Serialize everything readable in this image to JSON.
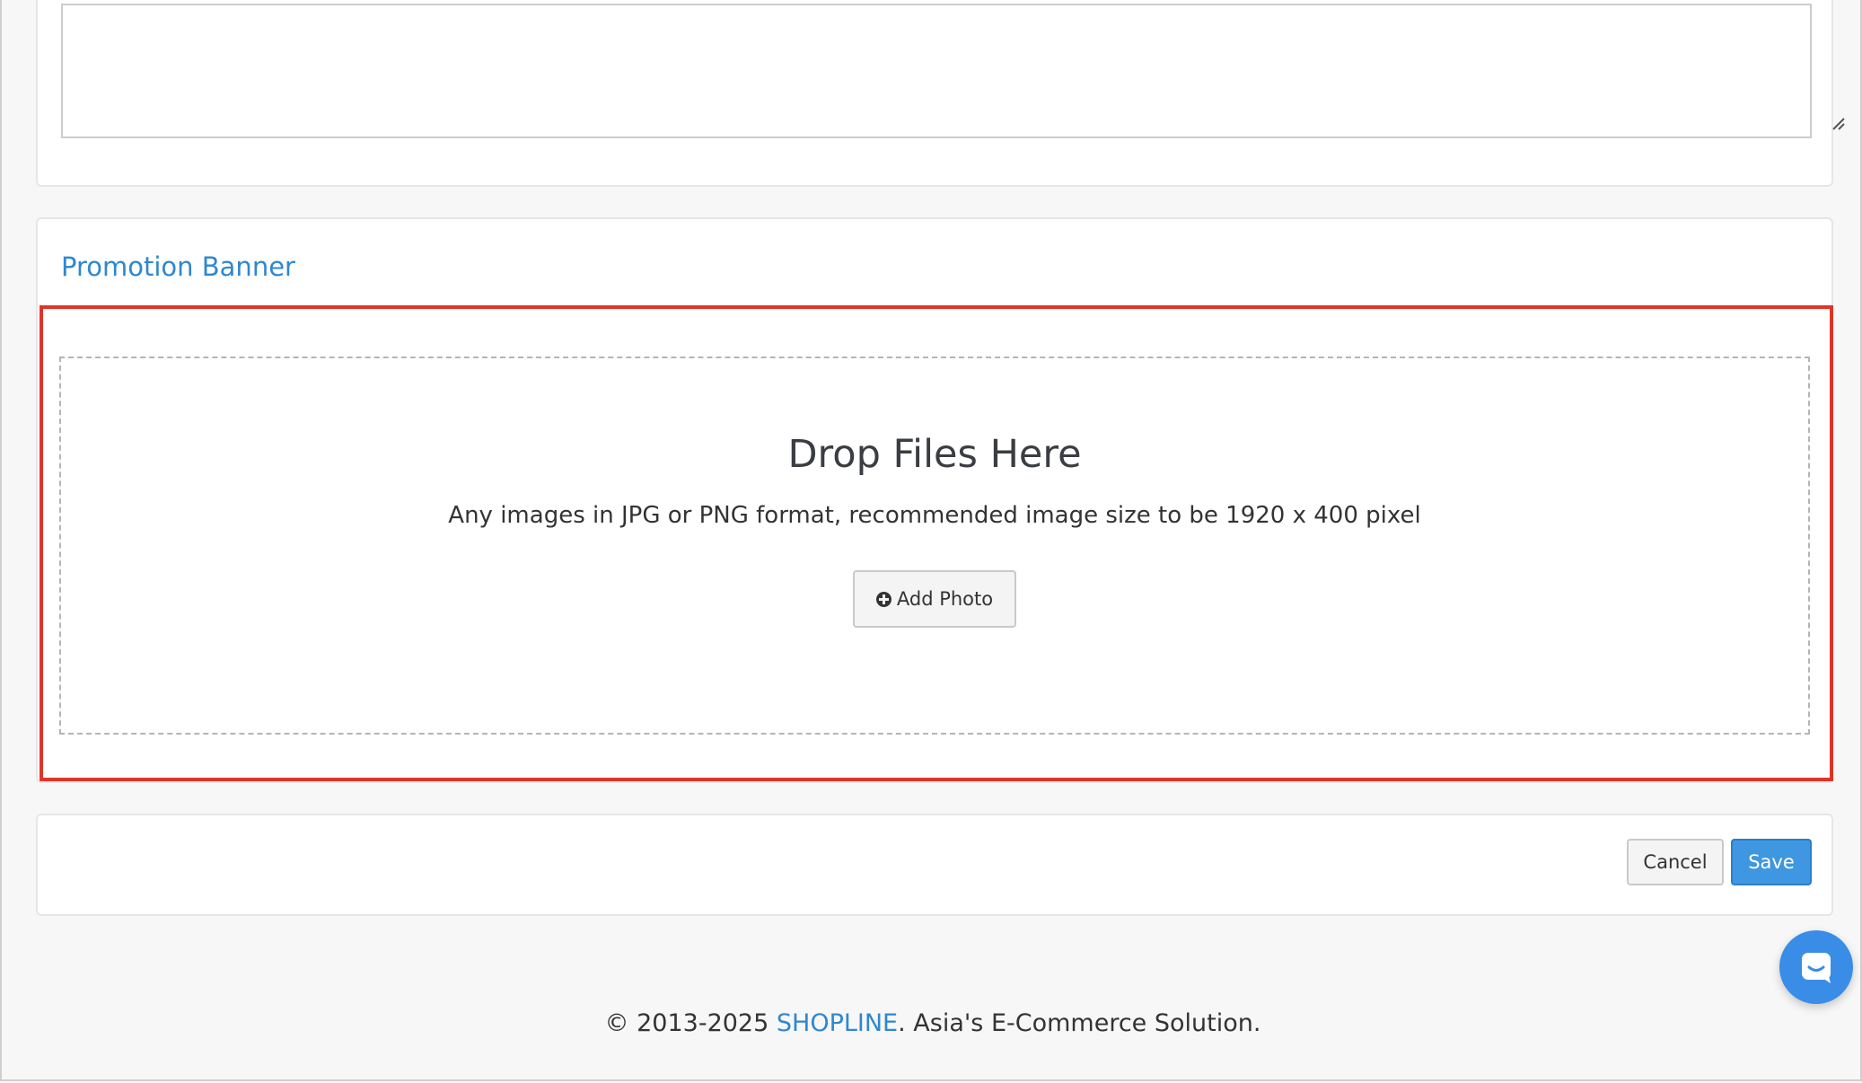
{
  "description_field": {
    "value": ""
  },
  "promotion_banner": {
    "title": "Promotion Banner",
    "drop_heading": "Drop Files Here",
    "drop_hint": "Any images in JPG or PNG format, recommended image size to be 1920 x 400 pixel",
    "add_photo_label": "Add Photo"
  },
  "actions": {
    "cancel_label": "Cancel",
    "save_label": "Save"
  },
  "footer": {
    "prefix": "© 2013-2025 ",
    "brand": "SHOPLINE",
    "suffix": ". Asia's E-Commerce Solution."
  },
  "colors": {
    "accent": "#2f87d0",
    "primary_button": "#3e97e0",
    "highlight": "#e0342a",
    "chat_button": "#3a8de6"
  },
  "icons": {
    "add_photo": "plus-circle-icon",
    "chat": "chat-icon",
    "resize": "resize-grip-icon"
  }
}
